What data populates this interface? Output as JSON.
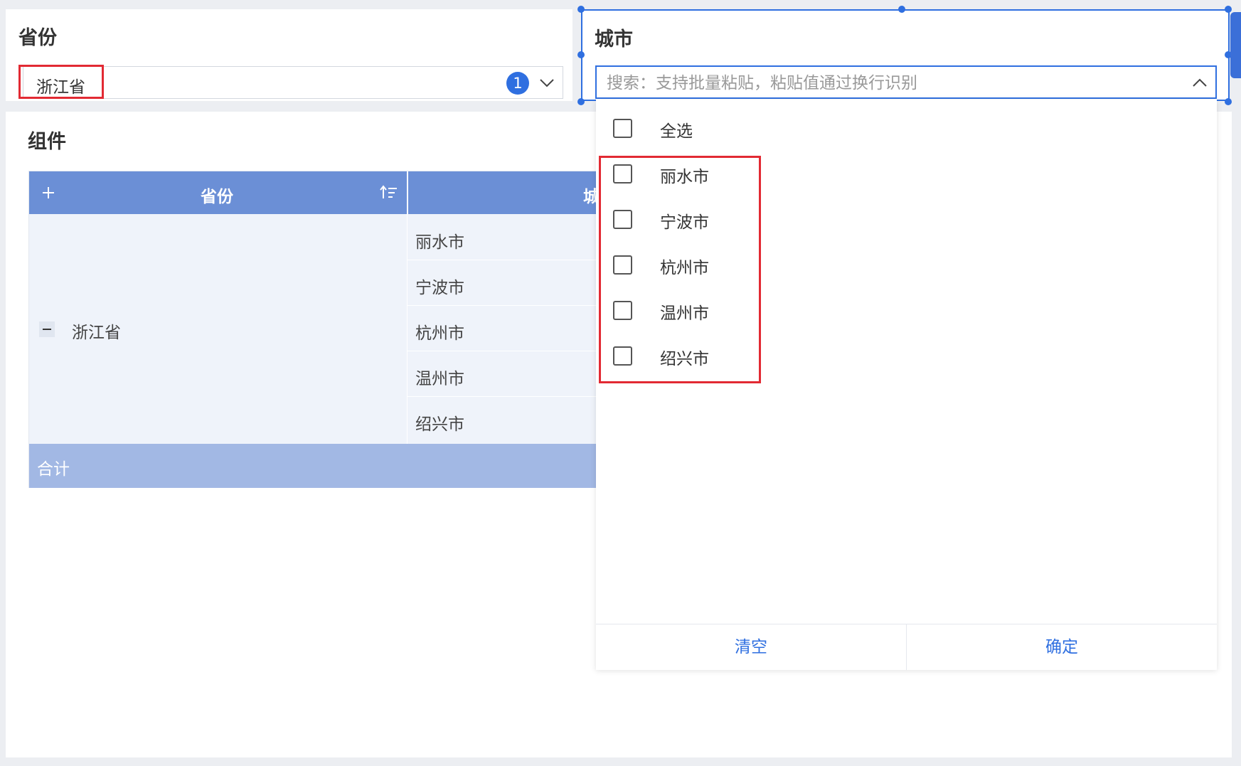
{
  "province_filter": {
    "label": "省份",
    "selected": "浙江省",
    "selected_count": "1"
  },
  "city_filter": {
    "label": "城市",
    "search_placeholder": "搜索：支持批量粘贴，粘贴值通过换行识别",
    "select_all": "全选",
    "options": [
      "丽水市",
      "宁波市",
      "杭州市",
      "温州市",
      "绍兴市"
    ],
    "clear_label": "清空",
    "confirm_label": "确定"
  },
  "component": {
    "title": "组件",
    "table": {
      "headers": [
        "省份",
        "城"
      ],
      "province": "浙江省",
      "cities": [
        "丽水市",
        "宁波市",
        "杭州市",
        "温州市",
        "绍兴市"
      ],
      "total_label": "合计"
    }
  },
  "colors": {
    "accent": "#2f6fe0",
    "header_bg": "#6b8fd6",
    "total_bg": "#a2b8e4",
    "highlight": "#e22a33"
  }
}
